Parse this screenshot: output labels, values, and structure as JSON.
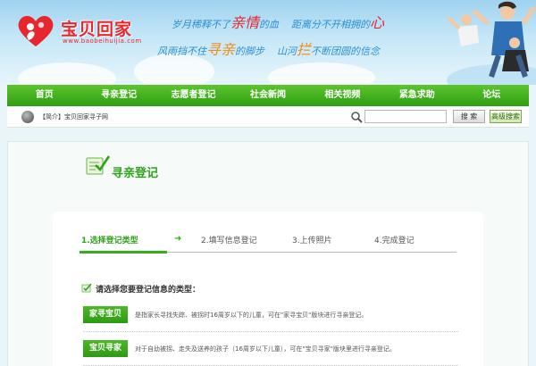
{
  "header": {
    "logo_text": "宝贝回家",
    "logo_url": "www.baobeihuijia.com",
    "slogan_1": {
      "a": "岁月稀释不了",
      "b": "亲情",
      "c": "的血",
      "d": "距离分不开相拥的",
      "e": "心"
    },
    "slogan_2": {
      "a": "风雨挡不住",
      "b": "寻亲",
      "c": "的脚步",
      "d": "山河",
      "e": "拦",
      "f": "不断团圆的信念"
    }
  },
  "nav": {
    "items": [
      {
        "label": "首页"
      },
      {
        "label": "寻亲登记"
      },
      {
        "label": "志愿者登记"
      },
      {
        "label": "社会新闻"
      },
      {
        "label": "相关视频"
      },
      {
        "label": "紧急求助"
      },
      {
        "label": "论坛"
      }
    ]
  },
  "subbar": {
    "intro": "【简介】宝贝回家寻子网",
    "search_value": "",
    "search_button": "搜 索",
    "advanced_button": "高级搜索"
  },
  "page": {
    "title": "寻亲登记",
    "steps": [
      {
        "label": "1.选择登记类型"
      },
      {
        "label": "2.填写信息登记"
      },
      {
        "label": "3.上传照片"
      },
      {
        "label": "4.完成登记"
      }
    ],
    "step_arrow": "➜",
    "prompt": "请选择您要登记信息的类型：",
    "types": [
      {
        "button": "家寻宝贝",
        "desc": "是指家长寻找失踪、被拐时16周岁以下的儿童，可在\"家寻宝贝\"版块进行寻亲登记。"
      },
      {
        "button": "宝贝寻家",
        "desc": "对于自幼被拐、走失及送养的孩子（16周岁以下儿童），可在\"宝贝寻家\"版块里进行寻亲登记。"
      }
    ]
  },
  "colors": {
    "nav_green": "#2f9e12",
    "title_green": "#2fa11a",
    "logo_red": "#e8262d",
    "slogan_blue": "#2d8fd0"
  },
  "icons": {
    "search": "magnifier-icon",
    "page": "notepad-check-icon",
    "prompt": "checklist-icon"
  }
}
